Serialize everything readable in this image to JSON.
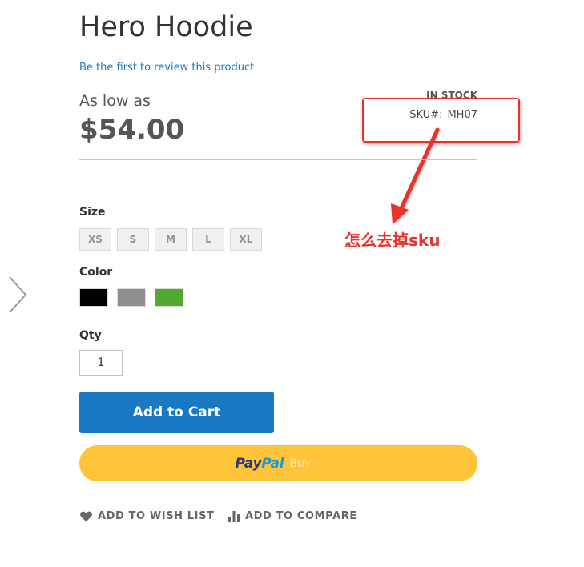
{
  "product": {
    "title": "Hero Hoodie",
    "review_link": "Be the first to review this product",
    "price_prefix": "As low as",
    "price": "$54.00",
    "stock_status": "IN STOCK",
    "sku_label": "SKU#:",
    "sku_value": "MH07"
  },
  "options": {
    "size_label": "Size",
    "sizes": [
      "XS",
      "S",
      "M",
      "L",
      "XL"
    ],
    "color_label": "Color",
    "colors": [
      "#000000",
      "#8f8f8f",
      "#53a92f"
    ],
    "qty_label": "Qty",
    "qty_value": "1"
  },
  "actions": {
    "add_to_cart": "Add to Cart",
    "wish_list": "ADD TO WISH LIST",
    "compare": "ADD TO COMPARE"
  },
  "paypal": {
    "pay": "Pay",
    "pal": "Pal",
    "suffix": "Buy N"
  },
  "annotation": {
    "text": "怎么去掉sku",
    "color": "#e8332a"
  },
  "theme": {
    "link_color": "#1979c3",
    "button_color": "#1979c3",
    "paypal_color": "#ffc439"
  }
}
